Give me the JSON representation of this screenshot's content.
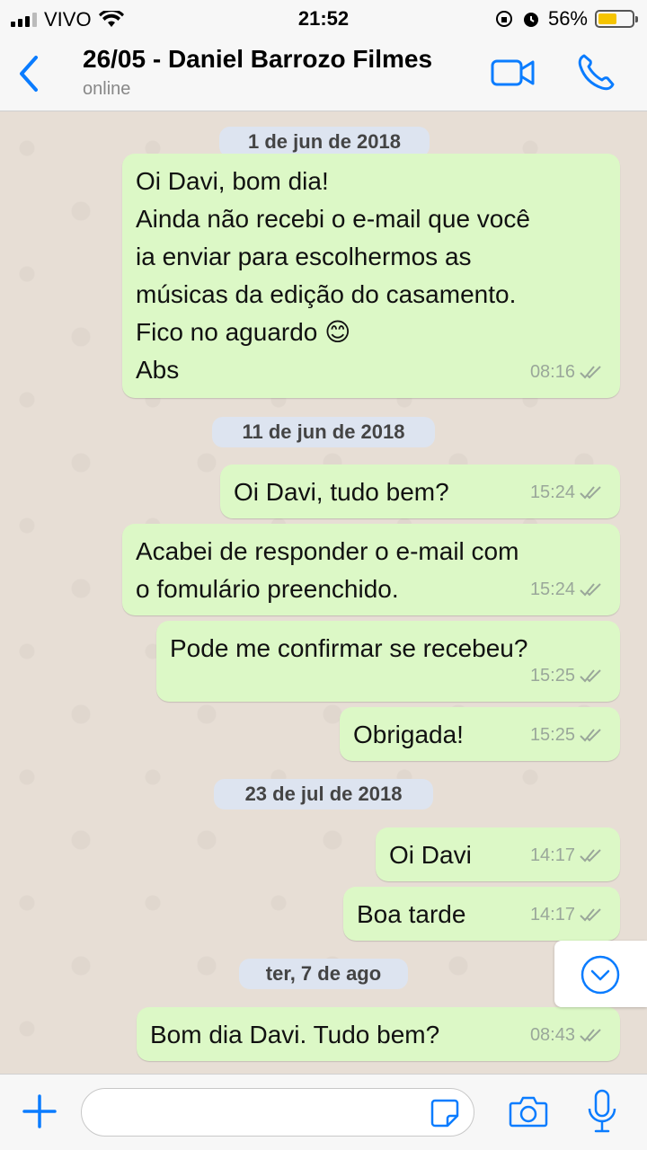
{
  "status_bar": {
    "carrier": "VIVO",
    "time": "21:52",
    "battery_percent": "56%",
    "battery_level": 0.56
  },
  "header": {
    "contact_name": "26/05 - Daniel Barrozo Filmes",
    "status": "online"
  },
  "messages": [
    {
      "date": "1 de jun de 2018"
    },
    {
      "text": "Oi Davi, bom dia!\nAinda não recebi o e-mail que você\nia enviar para escolhermos as\nmúsicas da edição do casamento.\nFico no aguardo 😊\nAbs",
      "time": "08:16"
    },
    {
      "date": "11 de jun de 2018"
    },
    {
      "text": "Oi Davi, tudo bem?",
      "time": "15:24"
    },
    {
      "text": "Acabei de responder o e-mail com\no fomulário preenchido.",
      "time": "15:24"
    },
    {
      "text": "Pode me confirmar se recebeu?",
      "time": "15:25"
    },
    {
      "text": "Obrigada!",
      "time": "15:25"
    },
    {
      "date": "23 de jul de 2018"
    },
    {
      "text": "Oi Davi",
      "time": "14:17"
    },
    {
      "text": "Boa tarde",
      "time": "14:17"
    },
    {
      "date": "ter, 7 de ago"
    },
    {
      "text": "Bom dia Davi. Tudo bem?",
      "time": "08:43"
    }
  ],
  "input": {
    "value": "",
    "placeholder": ""
  },
  "icons": {
    "back": "chevron-left-icon",
    "video": "video-call-icon",
    "call": "phone-icon",
    "scroll": "chevron-down-circle-icon",
    "plus": "plus-icon",
    "sticker": "sticker-icon",
    "camera": "camera-icon",
    "mic": "microphone-icon"
  },
  "colors": {
    "accent": "#0a7cff",
    "bubble": "#dcf8c6",
    "date_pill": "#dde4f0",
    "tick": "#9aa79a"
  }
}
